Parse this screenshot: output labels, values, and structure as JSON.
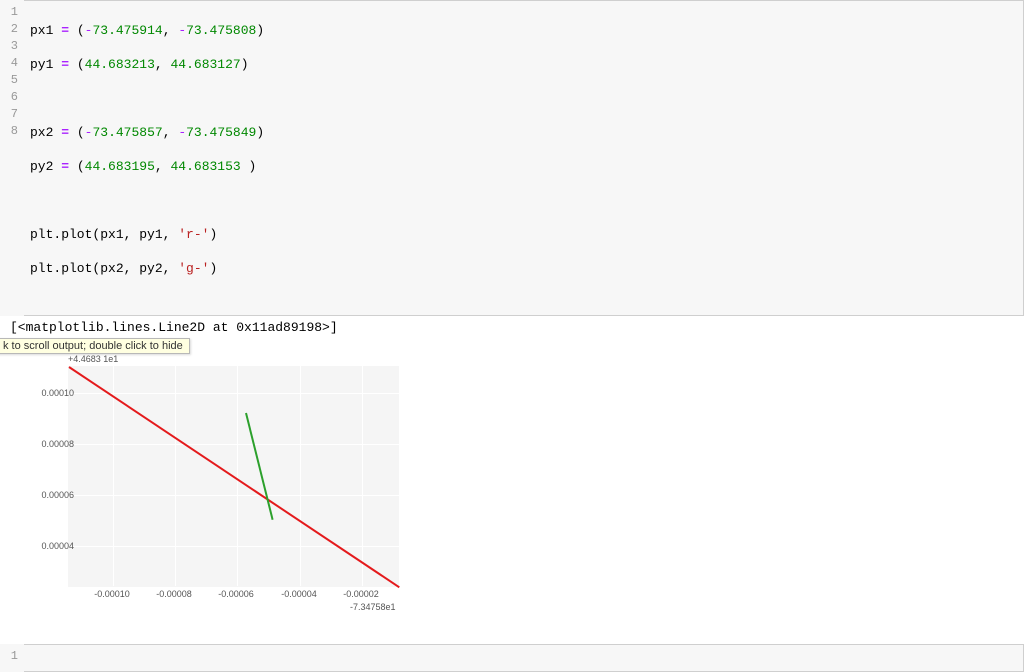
{
  "code": {
    "lines": {
      "l1": {
        "var": "px1",
        "a": "-73.475914",
        "b": "-73.475808"
      },
      "l2": {
        "var": "py1",
        "a": "44.683213",
        "b": "44.683127"
      },
      "l4": {
        "var": "px2",
        "a": "-73.475857",
        "b": "-73.475849"
      },
      "l5": {
        "var": "py2",
        "a": "44.683195",
        "b": "44.683153"
      },
      "l7": {
        "call": "plt.plot",
        "args": "(px1, py1, ",
        "str": "'r-'",
        "close": ")"
      },
      "l8": {
        "call": "plt.plot",
        "args": "(px2, py2, ",
        "str": "'g-'",
        "close": ")"
      }
    },
    "gutter": [
      "1",
      "2",
      "3",
      "4",
      "5",
      "6",
      "7",
      "8"
    ]
  },
  "output": {
    "repr": "[<matplotlib.lines.Line2D at 0x11ad89198>]"
  },
  "tooltip": "k to scroll output; double click to hide",
  "chart_data": {
    "type": "line",
    "series": [
      {
        "name": "r-",
        "color": "#e41a1c",
        "x": [
          -73.475914,
          -73.475808
        ],
        "y": [
          44.683213,
          44.683127
        ]
      },
      {
        "name": "g-",
        "color": "#2ca02c",
        "x": [
          -73.475857,
          -73.475849
        ],
        "y": [
          44.683195,
          44.683153
        ]
      }
    ],
    "xlabel": "",
    "ylabel": "",
    "x_offset_label": "-7.34758e1",
    "y_offset_label": "+4.4683 1e1",
    "x_ticks": [
      "-0.00010",
      "-0.00008",
      "-0.00006",
      "-0.00004",
      "-0.00002"
    ],
    "y_ticks": [
      "0.00004",
      "0.00006",
      "0.00008",
      "0.00010"
    ],
    "xlim": [
      -73.475914,
      -73.475808
    ],
    "ylim": [
      44.683127,
      44.683213
    ],
    "title": ""
  },
  "empty_cell_gutter": "1"
}
